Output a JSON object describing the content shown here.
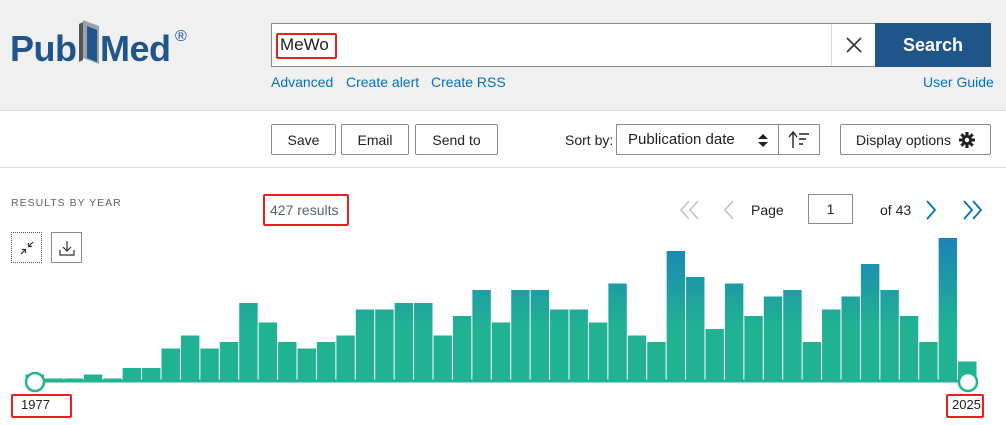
{
  "header": {
    "logo": {
      "part1": "Pub",
      "part2": "Med",
      "registered": "®"
    },
    "search": {
      "value": "MeWo",
      "button_label": "Search"
    },
    "links": {
      "advanced": "Advanced",
      "create_alert": "Create alert",
      "create_rss": "Create RSS",
      "user_guide": "User Guide"
    }
  },
  "toolbar": {
    "save": "Save",
    "email": "Email",
    "send_to": "Send to",
    "sort_by_label": "Sort by:",
    "sort_value": "Publication date",
    "display_options": "Display options"
  },
  "results": {
    "section_label": "RESULTS BY YEAR",
    "count_text": "427 results",
    "page_label": "Page",
    "page_value": "1",
    "page_of": "of 43"
  },
  "chart_data": {
    "type": "bar",
    "x": [
      1977,
      1978,
      1979,
      1980,
      1981,
      1982,
      1983,
      1984,
      1985,
      1986,
      1987,
      1988,
      1989,
      1990,
      1991,
      1992,
      1993,
      1994,
      1995,
      1996,
      1997,
      1998,
      1999,
      2000,
      2001,
      2002,
      2003,
      2004,
      2005,
      2006,
      2007,
      2008,
      2009,
      2010,
      2011,
      2012,
      2013,
      2014,
      2015,
      2016,
      2017,
      2018,
      2019,
      2020,
      2021,
      2022,
      2023,
      2024,
      2025
    ],
    "values": [
      1,
      0,
      0,
      1,
      0,
      2,
      2,
      5,
      7,
      5,
      6,
      12,
      9,
      6,
      5,
      6,
      7,
      11,
      11,
      12,
      12,
      7,
      10,
      14,
      9,
      14,
      14,
      11,
      11,
      9,
      15,
      7,
      6,
      20,
      16,
      8,
      15,
      10,
      13,
      14,
      6,
      11,
      13,
      18,
      14,
      10,
      6,
      22,
      3
    ],
    "range_start": "1977",
    "range_end": "2025",
    "colors": {
      "low": "#21b294",
      "high": "#1b82b8"
    }
  }
}
